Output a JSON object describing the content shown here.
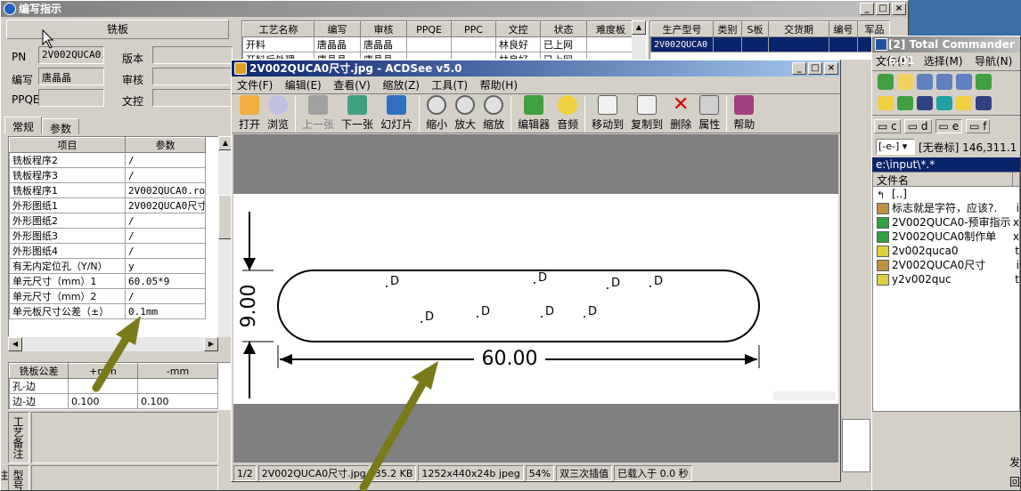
{
  "left_window": {
    "title": "编写指示",
    "section_header": "铣板",
    "fields": [
      {
        "label": "PN",
        "value": "2V002QUCA0"
      },
      {
        "label": "编写",
        "value": "唐晶晶"
      },
      {
        "label": "PPQE",
        "value": ""
      }
    ],
    "right_fields": [
      {
        "label": "版本",
        "value": ""
      },
      {
        "label": "审核",
        "value": ""
      },
      {
        "label": "文控",
        "value": ""
      }
    ],
    "tabs": [
      "常规",
      "参数"
    ],
    "param_headers": [
      "项目",
      "参数"
    ],
    "params": [
      [
        "铣板程序2",
        "/"
      ],
      [
        "铣板程序3",
        "/"
      ],
      [
        "铣板程序1",
        "2V002QUCA0.rou"
      ],
      [
        "外形图纸1",
        "2V002QUCA0尺寸"
      ],
      [
        "外形图纸2",
        "/"
      ],
      [
        "外形图纸3",
        "/"
      ],
      [
        "外形图纸4",
        "/"
      ],
      [
        "有无内定位孔（Y/N）",
        "y"
      ],
      [
        "单元尺寸（mm）1",
        "60.05*9"
      ],
      [
        "单元尺寸（mm）2",
        "/"
      ],
      [
        "单元板尺寸公差（±）",
        "0.1mm"
      ]
    ],
    "tol_headers": [
      "铣板公差",
      "+mm",
      "-mm"
    ],
    "tol_rows": [
      [
        "孔-边",
        "",
        ""
      ],
      [
        "边-边",
        "0.100",
        "0.100"
      ]
    ],
    "notes": [
      "工艺备注",
      "型号备注"
    ]
  },
  "process_table": {
    "headers": [
      "工艺名称",
      "编写",
      "审核",
      "PPQE",
      "PPC",
      "文控",
      "状态",
      "难度板"
    ],
    "rows": [
      [
        "开料",
        "唐晶晶",
        "唐晶晶",
        "",
        "",
        "林良好",
        "已上网",
        ""
      ],
      [
        "开料后处理",
        "唐晶晶",
        "唐晶晶",
        "",
        "",
        "林良好",
        "已上网",
        ""
      ]
    ]
  },
  "prod_table": {
    "headers": [
      "生产型号",
      "类别",
      "S板",
      "交货期",
      "编号",
      "军品"
    ],
    "selected": "2V002QUCA0"
  },
  "acdsee": {
    "title": "2V002QUCA0尺寸.jpg - ACDSee v5.0",
    "menu": [
      "文件(F)",
      "编辑(E)",
      "查看(V)",
      "缩放(Z)",
      "工具(T)",
      "帮助(H)"
    ],
    "tools": [
      "打开",
      "浏览",
      "上一张",
      "下一张",
      "幻灯片",
      "缩小",
      "放大",
      "缩放",
      "编辑器",
      "音频",
      "移动到",
      "复制到",
      "删除",
      "属性",
      "帮助"
    ],
    "drawing": {
      "height_dim": "9.00",
      "width_dim": "60.00",
      "marker": "D",
      "marker_count": 11
    },
    "status": [
      "1/2",
      "2V002QUCA0尺寸.jpg",
      "35.2 KB",
      "1252x440x24b jpeg",
      "54%",
      "双三次插值",
      "已载入于 0.0 秒"
    ]
  },
  "total_commander": {
    "title": "[2] Total Commander 6.01",
    "menu": [
      "文件(F)",
      "选择(M)",
      "导航(N)",
      "显"
    ],
    "drives": [
      "c",
      "d",
      "e",
      "f"
    ],
    "drive_select": "[-e-]",
    "drive_info": "[无卷标]  146,311.1",
    "path": "e:\\input\\*.*",
    "col_header": "文件名",
    "files": [
      {
        "name": "[..]",
        "ext": "",
        "icon": "up-icon"
      },
      {
        "name": "标志就是字符，应该?.",
        "ext": "i",
        "icon": "image-icon"
      },
      {
        "name": "2V002QUCA0-预审指示",
        "ext": "x",
        "icon": "excel-icon"
      },
      {
        "name": "2V002QUCA0制作单",
        "ext": "x",
        "icon": "excel-icon"
      },
      {
        "name": "2v002quca0",
        "ext": "t",
        "icon": "archive-icon"
      },
      {
        "name": "2V002QUCA0尺寸",
        "ext": "i",
        "icon": "image-icon"
      },
      {
        "name": "y2v002quc",
        "ext": "t",
        "icon": "archive-icon"
      }
    ],
    "bottom": [
      "发",
      "回"
    ]
  },
  "colors": {
    "titlebar": "#0a246a",
    "selection": "#0a246a",
    "arrow": "#7a7a1a",
    "desktop": "#3a6ea5"
  }
}
